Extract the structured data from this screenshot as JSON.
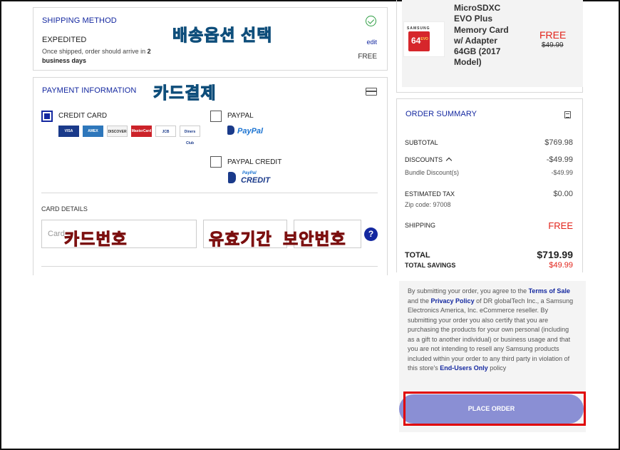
{
  "shipping": {
    "title": "SHIPPING METHOD",
    "method": "EXPEDITED",
    "desc_prefix": "Once shipped, order should arrive in ",
    "desc_days": "2",
    "desc_suffix": "business days",
    "edit_label": "edit",
    "price": "FREE",
    "annotation": "배송옵션 선택"
  },
  "payment": {
    "title": "PAYMENT INFORMATION",
    "annotation": "카드결제",
    "options": {
      "credit_card": "CREDIT CARD",
      "paypal": "PAYPAL",
      "paypal_logo": "PayPal",
      "paypal_credit": "PAYPAL CREDIT",
      "paypal_credit_logo_small": "PayPal",
      "paypal_credit_logo_big": "CREDIT"
    },
    "card_logos": [
      "VISA",
      "AMEX",
      "DISCOVER",
      "MasterCard",
      "JCB",
      "Diners Club"
    ],
    "card_details_label": "CARD DETAILS",
    "card_number_placeholder": "Card",
    "help": "?",
    "annotation_card_number": "카드번호",
    "annotation_expiry": "유효기간",
    "annotation_security": "보안번호"
  },
  "product": {
    "brand": "SAMSUNG",
    "card_size": "64",
    "card_label": "EVO",
    "name": "MicroSDXC EVO Plus Memory Card w/ Adapter 64GB (2017 Model)",
    "price": "FREE",
    "original_price": "$49.99"
  },
  "summary": {
    "title": "ORDER SUMMARY",
    "subtotal_label": "SUBTOTAL",
    "subtotal_value": "$769.98",
    "discounts_label": "DISCOUNTS",
    "discounts_value": "-$49.99",
    "bundle_label": "Bundle Discount(s)",
    "bundle_value": "-$49.99",
    "tax_label": "ESTIMATED TAX",
    "tax_value": "$0.00",
    "zip_label": "Zip code: 97008",
    "shipping_label": "SHIPPING",
    "shipping_value": "FREE",
    "total_label": "TOTAL",
    "total_value": "$719.99",
    "savings_label": "TOTAL SAVINGS",
    "savings_value": "$49.99"
  },
  "terms": {
    "text1": "By submitting your order, you agree to the ",
    "terms_link": "Terms of Sale",
    "text2": " and the ",
    "privacy_link": "Privacy Policy",
    "text3": " of DR globalTech Inc., a Samsung Electronics America, Inc. eCommerce reseller. By submitting your order you also certify that you are purchasing the products for your own personal (including as a gift to another individual) or business usage and that you are not intending to resell any Samsung products included within your order to any third party in violation of this store's ",
    "eula_link": "End-Users Only",
    "text4": " policy"
  },
  "place_order_label": "PLACE ORDER",
  "colors": {
    "brand_blue": "#1428a0",
    "accent_red": "#e2231a",
    "button": "#8a8fd4",
    "annotation_box": "#e00000"
  }
}
